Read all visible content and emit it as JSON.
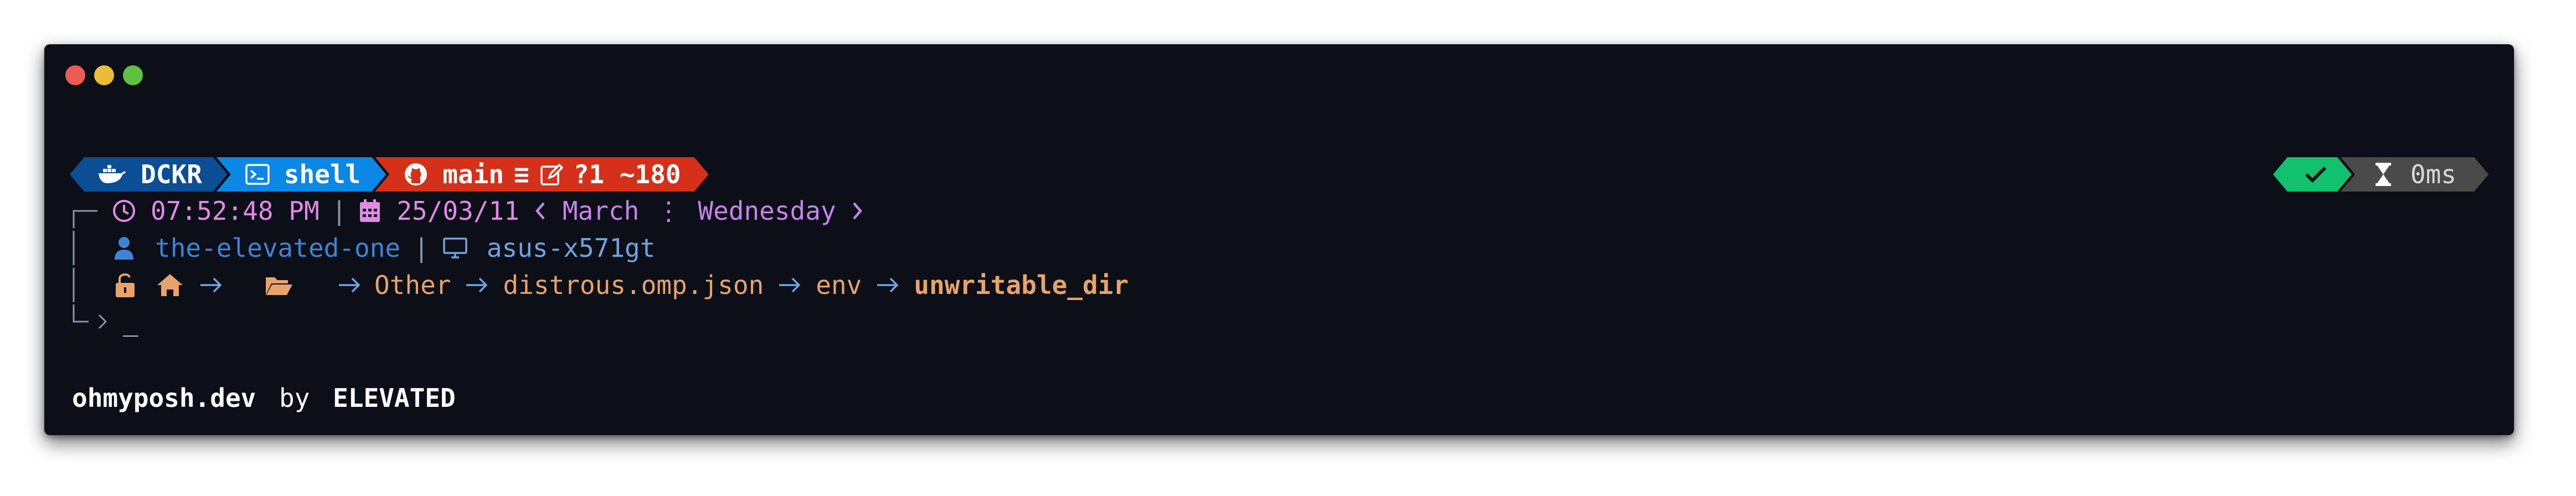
{
  "window": {
    "traffic_lights": {
      "red": "#ed5b55",
      "yellow": "#e9bd3a",
      "green": "#5fc144"
    }
  },
  "prompt": {
    "segments": [
      {
        "label": "DCKR",
        "icon": "docker-icon",
        "color": "#0b4e94"
      },
      {
        "label": "shell",
        "icon": "terminal-icon",
        "color": "#0b87e6"
      },
      {
        "branch": "main",
        "status": "≡",
        "changes": "?1 ~180",
        "icon": "github-icon",
        "edit_icon": "edit-icon",
        "color": "#d4301a"
      }
    ],
    "right": {
      "status_icon": "check-icon",
      "duration": "0ms",
      "duration_icon": "hourglass-icon"
    },
    "line1": {
      "time": "07:52:48 PM",
      "sep": "|",
      "date": "25/03/11",
      "month": "March",
      "dots": "⋮",
      "weekday": "Wednesday"
    },
    "line2": {
      "user": "the-elevated-one",
      "sep": "|",
      "host": "asus-x571gt"
    },
    "line3": {
      "path": [
        "Other",
        "distrous.omp.json",
        "env"
      ],
      "current": "unwritable_dir"
    },
    "line4": {
      "cursor": "_"
    }
  },
  "footer": {
    "site": "ohmyposh.dev",
    "by": "by",
    "author": "ELEVATED"
  }
}
